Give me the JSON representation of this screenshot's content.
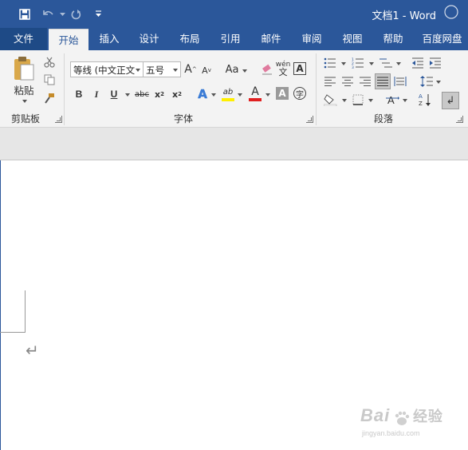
{
  "app": {
    "title": "文档1 - Word",
    "accent_color": "#2b579a"
  },
  "quick_access": [
    {
      "name": "save",
      "icon": "save-icon"
    },
    {
      "name": "undo",
      "icon": "undo-icon"
    },
    {
      "name": "redo",
      "icon": "redo-icon"
    },
    {
      "name": "customize",
      "icon": "chevron-down-icon"
    }
  ],
  "tabs": {
    "file": "文件",
    "home": "开始",
    "insert": "插入",
    "design": "设计",
    "layout": "布局",
    "references": "引用",
    "mailings": "邮件",
    "review": "审阅",
    "view": "视图",
    "help": "帮助",
    "baidu": "百度网盘"
  },
  "clipboard": {
    "paste_label": "粘贴",
    "group_label": "剪贴板"
  },
  "font": {
    "font_name": "等线 (中文正文",
    "font_size": "五号",
    "group_label": "字体",
    "grow_label": "A",
    "shrink_label": "A",
    "case_label": "Aa",
    "bold": "B",
    "italic": "I",
    "underline": "U",
    "strike": "abc",
    "sub": "x",
    "sub_index": "2",
    "sup": "x",
    "sup_index": "2",
    "phonetic_top": "wén",
    "phonetic_bottom": "文",
    "border_char": "A",
    "enclose_char": "字",
    "text_effect": "A",
    "highlight": "ab",
    "font_color": "A",
    "shade_char": "A"
  },
  "paragraph": {
    "group_label": "段落"
  },
  "watermark": {
    "brand": "Bai",
    "brand2": "经验",
    "url": "jingyan.baidu.com"
  }
}
